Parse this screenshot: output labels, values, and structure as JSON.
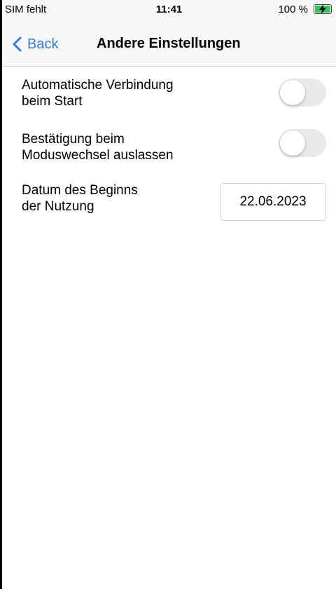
{
  "status_bar": {
    "carrier": "SIM fehlt",
    "time": "11:41",
    "battery": "100 %",
    "battery_icon": "battery-charging-icon",
    "battery_color": "#34c759"
  },
  "nav": {
    "back_label": "Back",
    "back_icon": "chevron-left-icon",
    "title": "Andere Einstellungen",
    "accent_color": "#2f7bf5"
  },
  "settings": {
    "auto_connect": {
      "label_line1": "Automatische Verbindung",
      "label_line2": "beim Start",
      "enabled": false
    },
    "skip_confirm": {
      "label_line1": "Bestätigung beim",
      "label_line2": "Moduswechsel auslassen",
      "enabled": false
    },
    "start_date": {
      "label_line1": "Datum des Beginns",
      "label_line2": "der Nutzung",
      "value": "22.06.2023"
    }
  }
}
